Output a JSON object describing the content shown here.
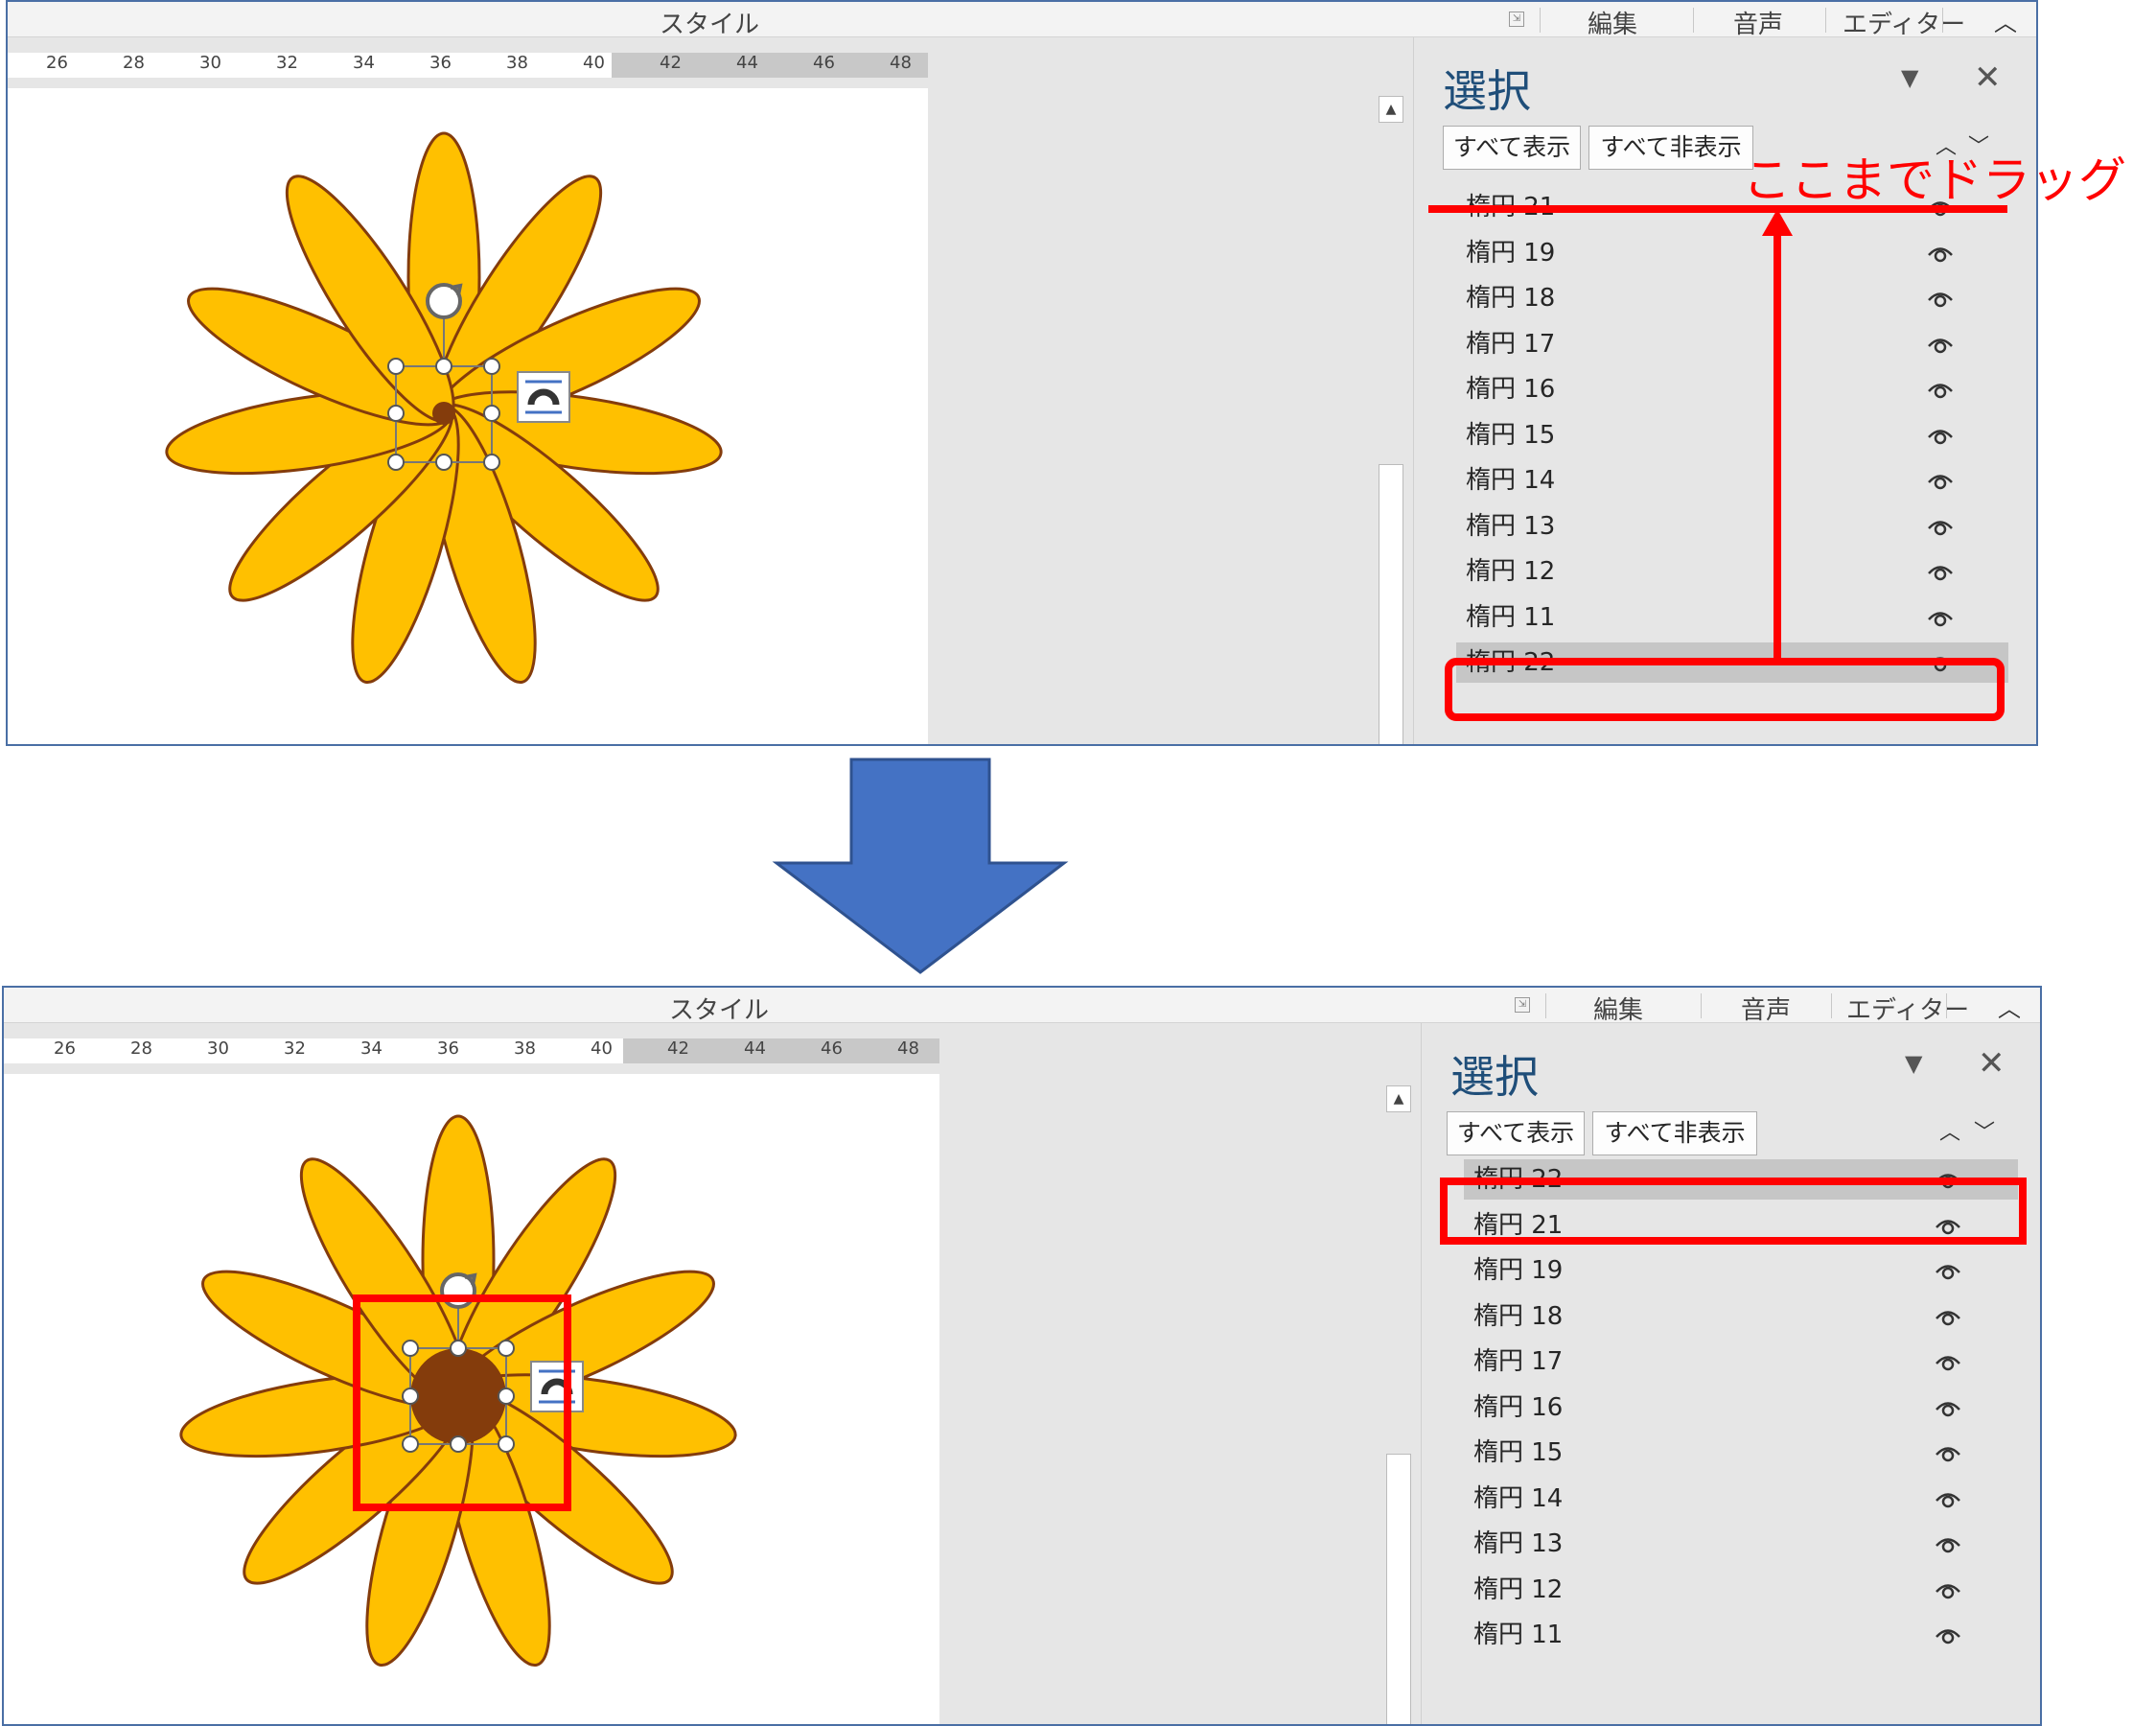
{
  "before": {
    "ribbon": {
      "style": "スタイル",
      "edit": "編集",
      "voice": "音声",
      "editor": "エディター"
    },
    "ruler_ticks": [
      "26",
      "28",
      "30",
      "32",
      "34",
      "36",
      "38",
      "40",
      "42",
      "44",
      "46",
      "48"
    ],
    "pane": {
      "title": "選択",
      "show_all": "すべて表示",
      "hide_all": "すべて非表示",
      "items": [
        "楕円 21",
        "楕円 19",
        "楕円 18",
        "楕円 17",
        "楕円 16",
        "楕円 15",
        "楕円 14",
        "楕円 13",
        "楕円 12",
        "楕円 11",
        "楕円 22"
      ],
      "selected_index": 10
    },
    "annotation": "ここまでドラッグ"
  },
  "after": {
    "ribbon": {
      "style": "スタイル",
      "edit": "編集",
      "voice": "音声",
      "editor": "エディター"
    },
    "ruler_ticks": [
      "26",
      "28",
      "30",
      "32",
      "34",
      "36",
      "38",
      "40",
      "42",
      "44",
      "46",
      "48"
    ],
    "pane": {
      "title": "選択",
      "show_all": "すべて表示",
      "hide_all": "すべて非表示",
      "items": [
        "楕円 22",
        "楕円 21",
        "楕円 19",
        "楕円 18",
        "楕円 17",
        "楕円 16",
        "楕円 15",
        "楕円 14",
        "楕円 13",
        "楕円 12",
        "楕円 11"
      ],
      "selected_index": 0
    }
  },
  "colors": {
    "petal_fill": "#ffc000",
    "petal_stroke": "#843c0c",
    "center_fill": "#843c0c",
    "arrow_fill": "#4472c4",
    "highlight": "#ff0000",
    "pane_title": "#1f4e79"
  },
  "icons": [
    "eye-icon",
    "rotate-handle-icon",
    "layout-options-icon",
    "pane-options-icon",
    "close-icon",
    "chevron-up-icon",
    "chevron-down-icon",
    "scroll-up-icon"
  ]
}
